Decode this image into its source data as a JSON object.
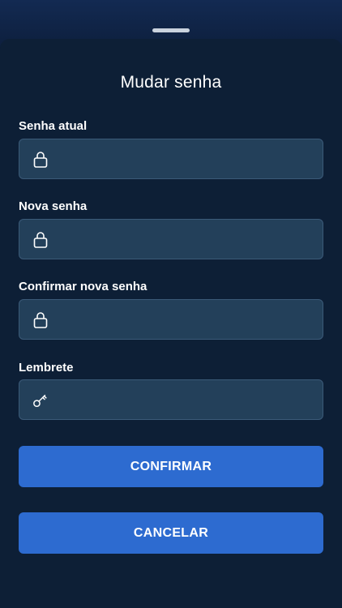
{
  "sheet": {
    "title": "Mudar senha"
  },
  "fields": {
    "current_password": {
      "label": "Senha atual",
      "value": "",
      "icon": "lock-icon"
    },
    "new_password": {
      "label": "Nova senha",
      "value": "",
      "icon": "lock-icon"
    },
    "confirm_password": {
      "label": "Confirmar nova senha",
      "value": "",
      "icon": "lock-icon"
    },
    "hint": {
      "label": "Lembrete",
      "value": "",
      "icon": "key-icon"
    }
  },
  "actions": {
    "confirm_label": "CONFIRMAR",
    "cancel_label": "CANCELAR"
  },
  "colors": {
    "background": "#0d1f36",
    "field_background": "#23405a",
    "field_border": "#3b5a78",
    "button": "#2d6bd0",
    "text": "#ffffff"
  }
}
